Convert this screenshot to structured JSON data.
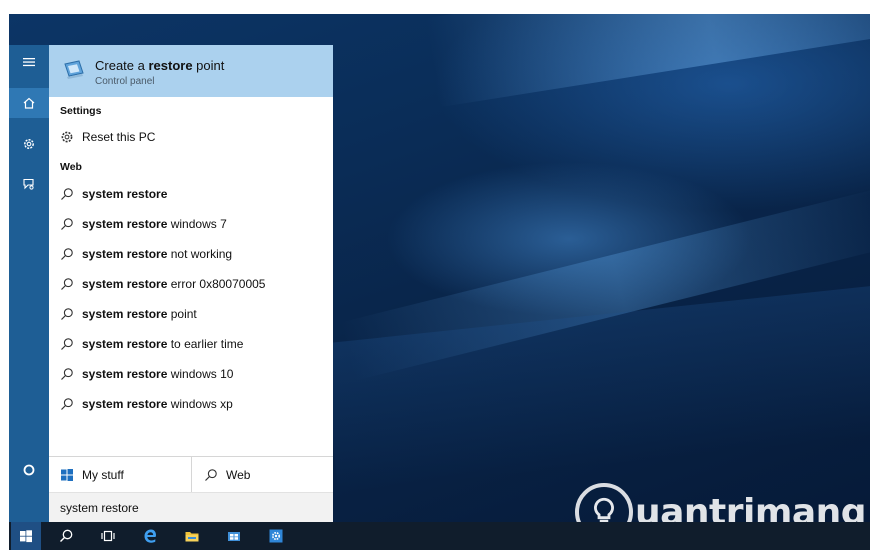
{
  "best_match": {
    "title_prefix": "Create a ",
    "title_bold": "restore",
    "title_suffix": " point",
    "subtitle": "Control panel",
    "icon": "restore-point-icon"
  },
  "sections": {
    "settings": "Settings",
    "web": "Web"
  },
  "settings_items": [
    {
      "label": "Reset this PC",
      "icon": "gear-icon"
    }
  ],
  "web_suggestions": [
    {
      "bold": "system restore",
      "rest": ""
    },
    {
      "bold": "system restore",
      "rest": " windows 7"
    },
    {
      "bold": "system restore",
      "rest": " not working"
    },
    {
      "bold": "system restore",
      "rest": " error 0x80070005"
    },
    {
      "bold": "system restore",
      "rest": " point"
    },
    {
      "bold": "system restore",
      "rest": " to earlier time"
    },
    {
      "bold": "system restore",
      "rest": " windows 10"
    },
    {
      "bold": "system restore",
      "rest": " windows xp"
    }
  ],
  "bottom_tabs": {
    "my_stuff": "My stuff",
    "web": "Web"
  },
  "search": {
    "value": "system restore"
  },
  "rail_icons": [
    "hamburger-icon",
    "home-icon",
    "settings-icon",
    "feedback-icon",
    "cortana-icon"
  ],
  "taskbar_icons": [
    "windows-start-icon",
    "search-icon",
    "task-view-icon",
    "edge-icon",
    "file-explorer-icon",
    "store-icon",
    "settings-icon"
  ],
  "watermark": {
    "text": "uantrimang"
  },
  "colors": {
    "rail": "#1e5e95",
    "best_match_bg": "#abd1ee",
    "taskbar": "#101d2c",
    "accent": "#2f78b4"
  }
}
